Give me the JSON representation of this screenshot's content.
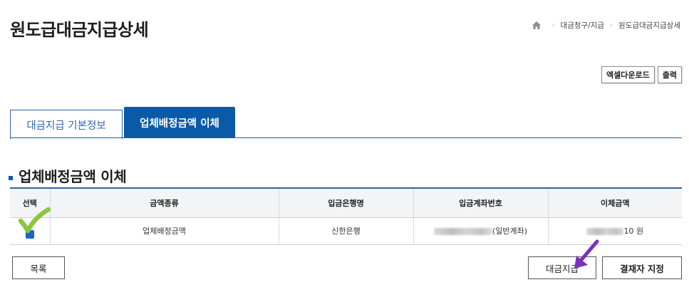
{
  "page": {
    "title": "원도급대금지급상세"
  },
  "breadcrumb": {
    "items": [
      "대금청구/지급",
      "원도급대금지급상세"
    ]
  },
  "toolbar": {
    "excel_label": "엑셀다운로드",
    "print_label": "출력"
  },
  "tabs": [
    {
      "label": "대금지급 기본정보",
      "active": false
    },
    {
      "label": "업체배정금액 이체",
      "active": true
    }
  ],
  "section": {
    "title": "업체배정금액 이체"
  },
  "table": {
    "headers": [
      "선택",
      "금액종류",
      "입금은행명",
      "입금계좌번호",
      "이체금액"
    ],
    "rows": [
      {
        "checked": true,
        "amount_type": "업체배정금액",
        "bank": "신한은행",
        "account_suffix": "(일반계좌)",
        "amount_suffix": "10 원"
      }
    ]
  },
  "buttons": {
    "list_label": "목록",
    "pay_label": "대금지급",
    "approver_label": "결재자 지정"
  },
  "annotations": {
    "check_color": "#8cc63f",
    "arrow_color": "#7b2fbf"
  },
  "colors": {
    "accent": "#0b5aa8",
    "tab_border": "#2c63a8"
  }
}
